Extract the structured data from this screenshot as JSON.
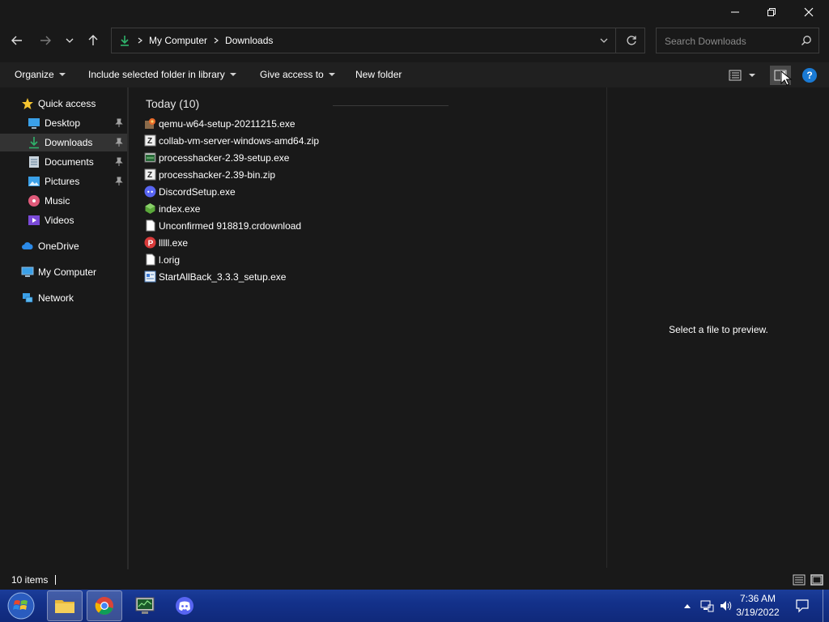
{
  "window": {
    "controls": {
      "minimize": "minimize",
      "restore": "restore",
      "close": "close"
    }
  },
  "nav": {
    "address": {
      "root": "My Computer",
      "current": "Downloads"
    },
    "search_placeholder": "Search Downloads"
  },
  "toolbar": {
    "organize": "Organize",
    "include_library": "Include selected folder in library",
    "give_access": "Give access to",
    "new_folder": "New folder"
  },
  "sidebar": {
    "quick_access": "Quick access",
    "items": [
      {
        "label": "Desktop",
        "icon": "desktop-icon",
        "pinned": true
      },
      {
        "label": "Downloads",
        "icon": "downloads-icon",
        "pinned": true,
        "selected": true
      },
      {
        "label": "Documents",
        "icon": "documents-icon",
        "pinned": true
      },
      {
        "label": "Pictures",
        "icon": "pictures-icon",
        "pinned": true
      },
      {
        "label": "Music",
        "icon": "music-icon"
      },
      {
        "label": "Videos",
        "icon": "videos-icon"
      }
    ],
    "onedrive": "OneDrive",
    "my_computer": "My Computer",
    "network": "Network"
  },
  "content": {
    "group_header": "Today (10)",
    "files": [
      {
        "name": "qemu-w64-setup-20211215.exe",
        "icon": "installer-icon"
      },
      {
        "name": "collab-vm-server-windows-amd64.zip",
        "icon": "zip-icon"
      },
      {
        "name": "processhacker-2.39-setup.exe",
        "icon": "exe-window-icon"
      },
      {
        "name": "processhacker-2.39-bin.zip",
        "icon": "zip-icon"
      },
      {
        "name": "DiscordSetup.exe",
        "icon": "discord-icon"
      },
      {
        "name": "index.exe",
        "icon": "green-cube-icon"
      },
      {
        "name": "Unconfirmed 918819.crdownload",
        "icon": "blank-file-icon"
      },
      {
        "name": "lllll.exe",
        "icon": "red-p-icon"
      },
      {
        "name": "l.orig",
        "icon": "blank-file-icon"
      },
      {
        "name": "StartAllBack_3.3.3_setup.exe",
        "icon": "setup-icon"
      }
    ]
  },
  "preview": {
    "message": "Select a file to preview."
  },
  "status": {
    "count": "10 items"
  },
  "taskbar": {
    "time": "7:36 AM",
    "date": "3/19/2022"
  },
  "colors": {
    "background": "#191919",
    "toolbar": "#202020",
    "selected": "#333333",
    "taskbar": "#13318a",
    "help": "#1a7ad4"
  }
}
